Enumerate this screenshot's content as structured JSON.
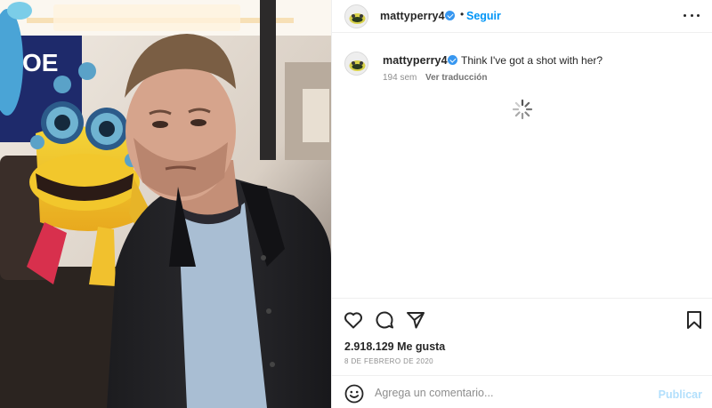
{
  "post": {
    "username": "mattyperry4",
    "follow_label": "Seguir",
    "separator": "•",
    "caption": "Think I've got a shot with her?",
    "age": "194 sem",
    "translate_label": "Ver traducción",
    "likes": "2.918.129 Me gusta",
    "date": "8 DE FEBRERO DE 2020"
  },
  "photo": {
    "sign_text": "OE"
  },
  "comment": {
    "placeholder": "Agrega un comentario...",
    "publish_label": "Publicar"
  },
  "icons": {
    "verified": "verified-badge-icon",
    "more": "more-options-icon",
    "like": "heart-icon",
    "comment": "comment-bubble-icon",
    "share": "paper-plane-icon",
    "save": "bookmark-icon",
    "emoji": "emoji-smiley-icon",
    "loading": "loading-spinner-icon"
  },
  "colors": {
    "accent": "#0095f6",
    "verified": "#3797f0",
    "publish_disabled": "#b2dffc",
    "text": "#262626",
    "muted": "#8e8e8e"
  }
}
